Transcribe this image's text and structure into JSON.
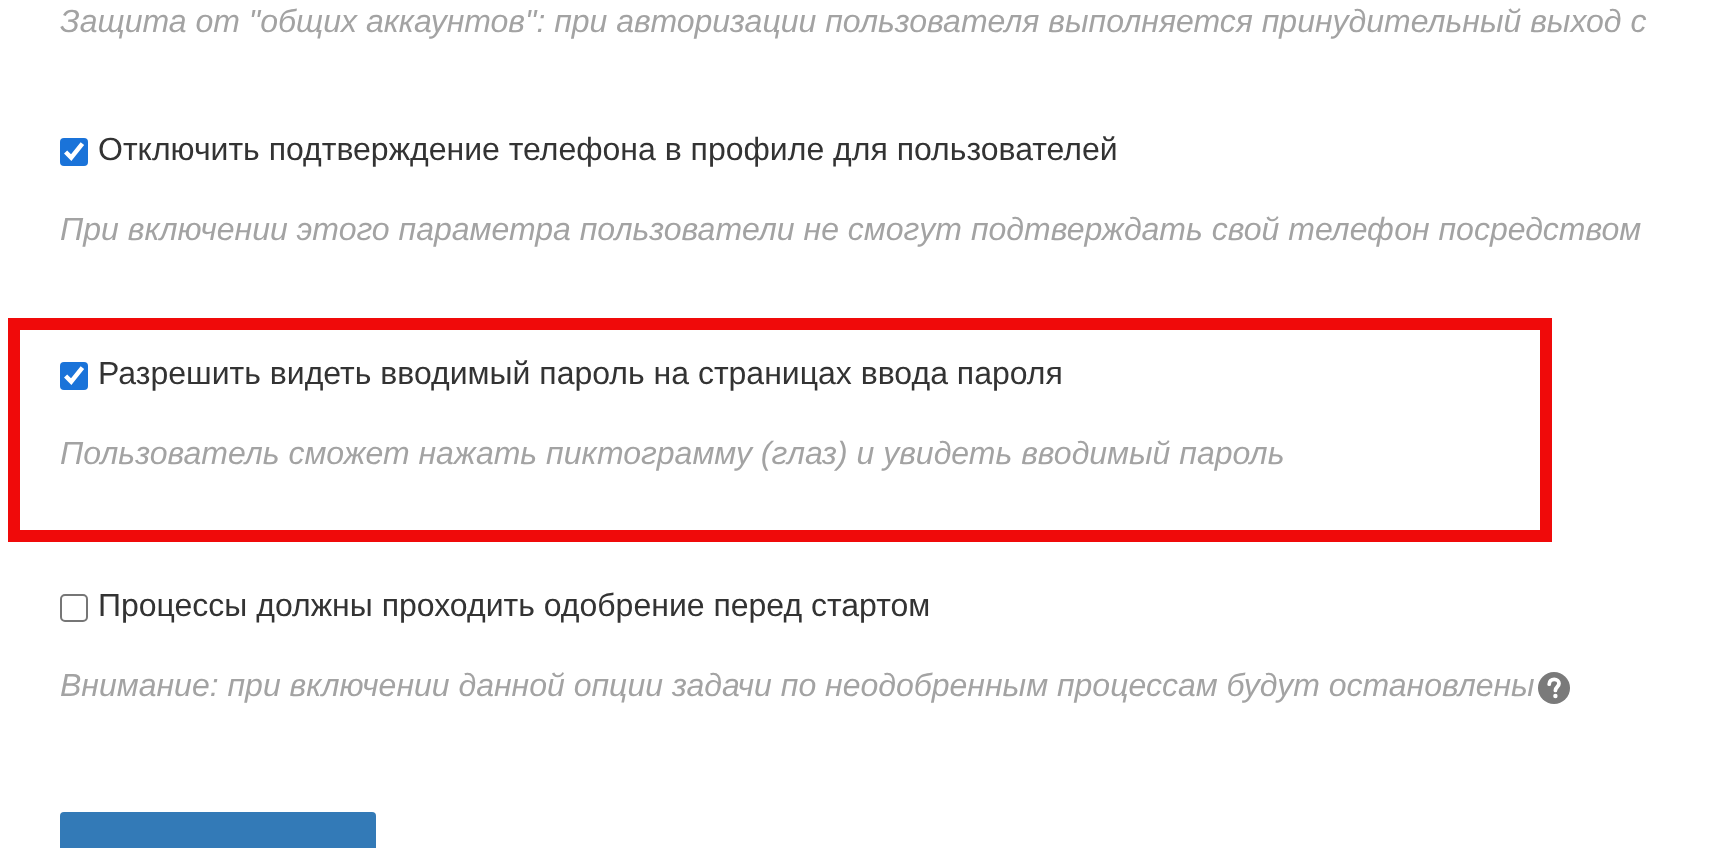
{
  "options": [
    {
      "description": "Защита от \"общих аккаунтов\": при авторизации пользователя выполняется принудительный выход с",
      "highlighted": false,
      "help": false
    },
    {
      "label": "Отключить подтверждение телефона в профиле для пользователей",
      "checked": true,
      "description": "При включении этого параметра пользователи не смогут подтверждать свой телефон посредством",
      "highlighted": false,
      "help": false
    },
    {
      "label": "Разрешить видеть вводимый пароль на страницах ввода пароля",
      "checked": true,
      "description": "Пользователь сможет нажать пиктограмму (глаз) и увидеть вводимый пароль",
      "highlighted": true,
      "help": false
    },
    {
      "label": "Процессы должны проходить одобрение перед стартом",
      "checked": false,
      "description": "Внимание: при включении данной опции задачи по неодобренным процессам будут остановлены",
      "highlighted": false,
      "help": true
    }
  ]
}
